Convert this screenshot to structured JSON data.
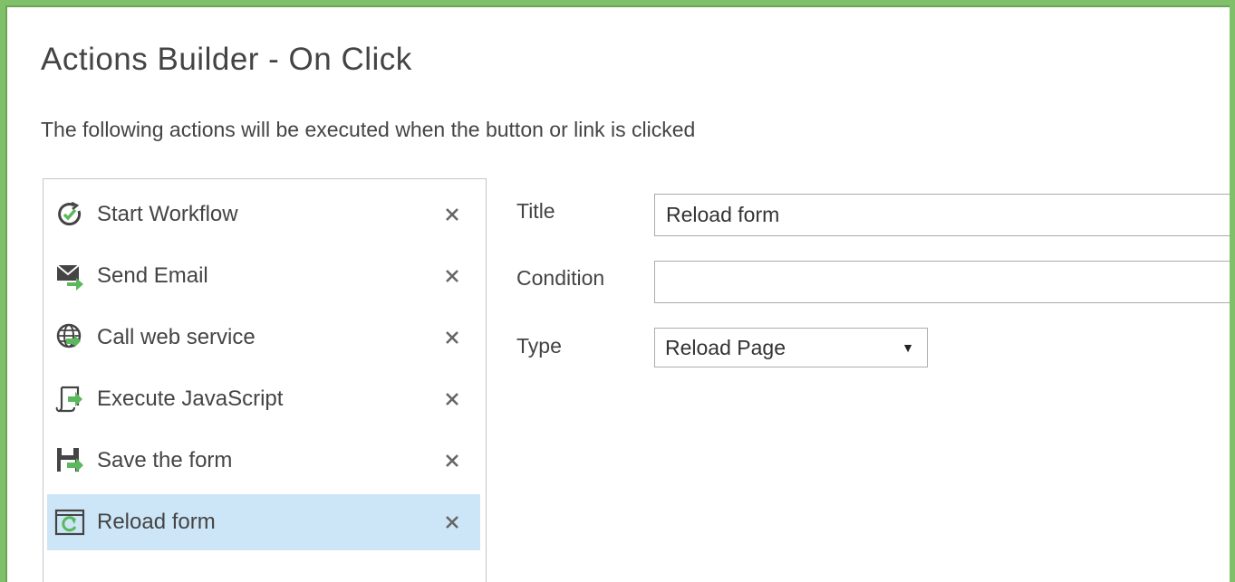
{
  "dialog": {
    "title": "Actions Builder - On Click",
    "subtitle": "The following actions will be executed when the button or link is clicked"
  },
  "actions": [
    {
      "label": "Start Workflow",
      "icon": "start-workflow-icon",
      "selected": false
    },
    {
      "label": "Send Email",
      "icon": "send-email-icon",
      "selected": false
    },
    {
      "label": "Call web service",
      "icon": "web-service-icon",
      "selected": false
    },
    {
      "label": "Execute JavaScript",
      "icon": "javascript-icon",
      "selected": false
    },
    {
      "label": "Save the form",
      "icon": "save-form-icon",
      "selected": false
    },
    {
      "label": "Reload form",
      "icon": "reload-form-icon",
      "selected": true
    }
  ],
  "remove_glyph": "✕",
  "form": {
    "title_label": "Title",
    "title_value": "Reload form",
    "condition_label": "Condition",
    "condition_value": "",
    "type_label": "Type",
    "type_value": "Reload Page",
    "type_arrow": "▼"
  },
  "colors": {
    "frame_border": "#7fc068",
    "selected_bg": "#cde6f7",
    "icon_green": "#5cb85c",
    "text": "#444444"
  }
}
